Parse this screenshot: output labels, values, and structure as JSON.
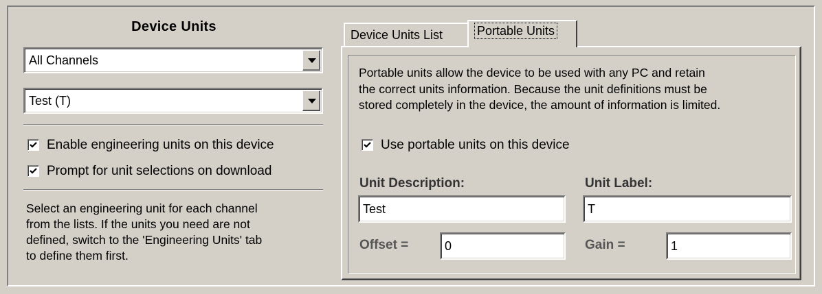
{
  "left": {
    "title": "Device Units",
    "channel_select": {
      "value": "All Channels"
    },
    "unit_select": {
      "value": "Test (T)"
    },
    "enable_units": {
      "label": "Enable engineering units on this device",
      "checked": true
    },
    "prompt_units": {
      "label": "Prompt for unit selections on download",
      "checked": true
    },
    "help_text_lines": [
      "Select an engineering unit for each channel",
      "from the lists. If the units you need are not",
      "defined, switch to the 'Engineering Units' tab",
      "to define them first."
    ]
  },
  "tabs": [
    {
      "label": "Device Units List",
      "active": false
    },
    {
      "label": "Portable Units",
      "active": true
    }
  ],
  "portable": {
    "description_lines": [
      "Portable units allow the device to be used with any PC and retain",
      "the correct units information. Because the unit definitions must be",
      "stored completely in the device, the amount of information is limited."
    ],
    "use_portable": {
      "label": "Use portable units on this device",
      "checked": true
    },
    "unit_description": {
      "label": "Unit Description:",
      "value": "Test"
    },
    "unit_label": {
      "label": "Unit Label:",
      "value": "T"
    },
    "offset": {
      "label": "Offset =",
      "value": "0"
    },
    "gain": {
      "label": "Gain =",
      "value": "1"
    }
  },
  "colors": {
    "face": "#d4d0c8",
    "shadow": "#808080",
    "highlight": "#ffffff"
  }
}
